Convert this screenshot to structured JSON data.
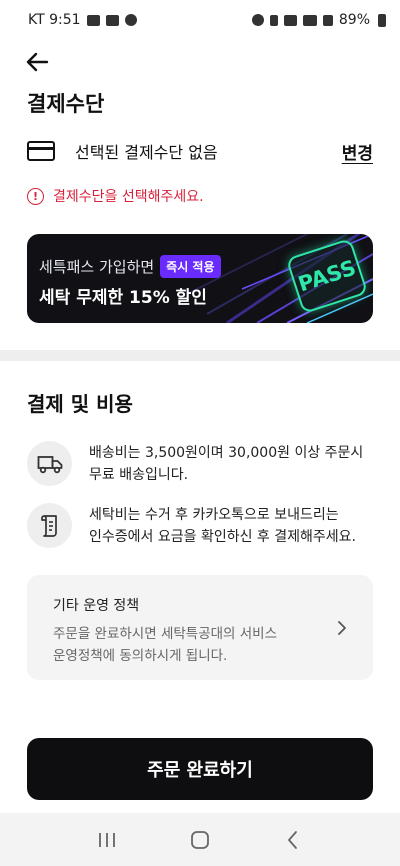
{
  "status_bar": {
    "carrier_time": "KT 9:51",
    "battery": "89%",
    "icons_left": [
      "image-icon",
      "sync-icon",
      "chat-icon"
    ],
    "icons_right": [
      "alarm-icon",
      "bluetooth-icon",
      "wifi-icon",
      "hd-icon",
      "signal-icon",
      "battery-icon"
    ]
  },
  "header": {
    "back_icon": "arrow-left-icon",
    "title": "결제수단"
  },
  "payment_method": {
    "icon": "credit-card-icon",
    "label": "선택된 결제수단 없음",
    "change_label": "변경"
  },
  "error": {
    "icon": "alert-circle-icon",
    "message": "결제수단을 선택해주세요.",
    "color": "#d6233b"
  },
  "banner": {
    "line1": "세특패스 가입하면",
    "chip": "즉시 적용",
    "line2": "세탁 무제한 15% 할인",
    "badge": "PASS",
    "chip_color": "#6a2bff",
    "badge_color": "#2de8a8"
  },
  "costs": {
    "title": "결제 및 비용",
    "items": [
      {
        "icon": "delivery-truck-icon",
        "line1": "배송비는 3,500원이며 30,000원 이상 주문시",
        "line2": "무료 배송입니다."
      },
      {
        "icon": "receipt-icon",
        "line1": "세탁비는 수거 후 카카오톡으로 보내드리는",
        "line2": "인수증에서 요금을 확인하신 후 결제해주세요."
      }
    ]
  },
  "policy": {
    "title": "기타 운영 정책",
    "line1": "주문을 완료하시면 세탁특공대의 서비스",
    "line2": "운영정책에 동의하시게 됩니다.",
    "icon": "chevron-right-icon"
  },
  "cta": {
    "label": "주문 완료하기"
  },
  "nav": {
    "recent_icon": "recent-apps-icon",
    "home_icon": "home-icon",
    "back_icon": "back-icon"
  }
}
